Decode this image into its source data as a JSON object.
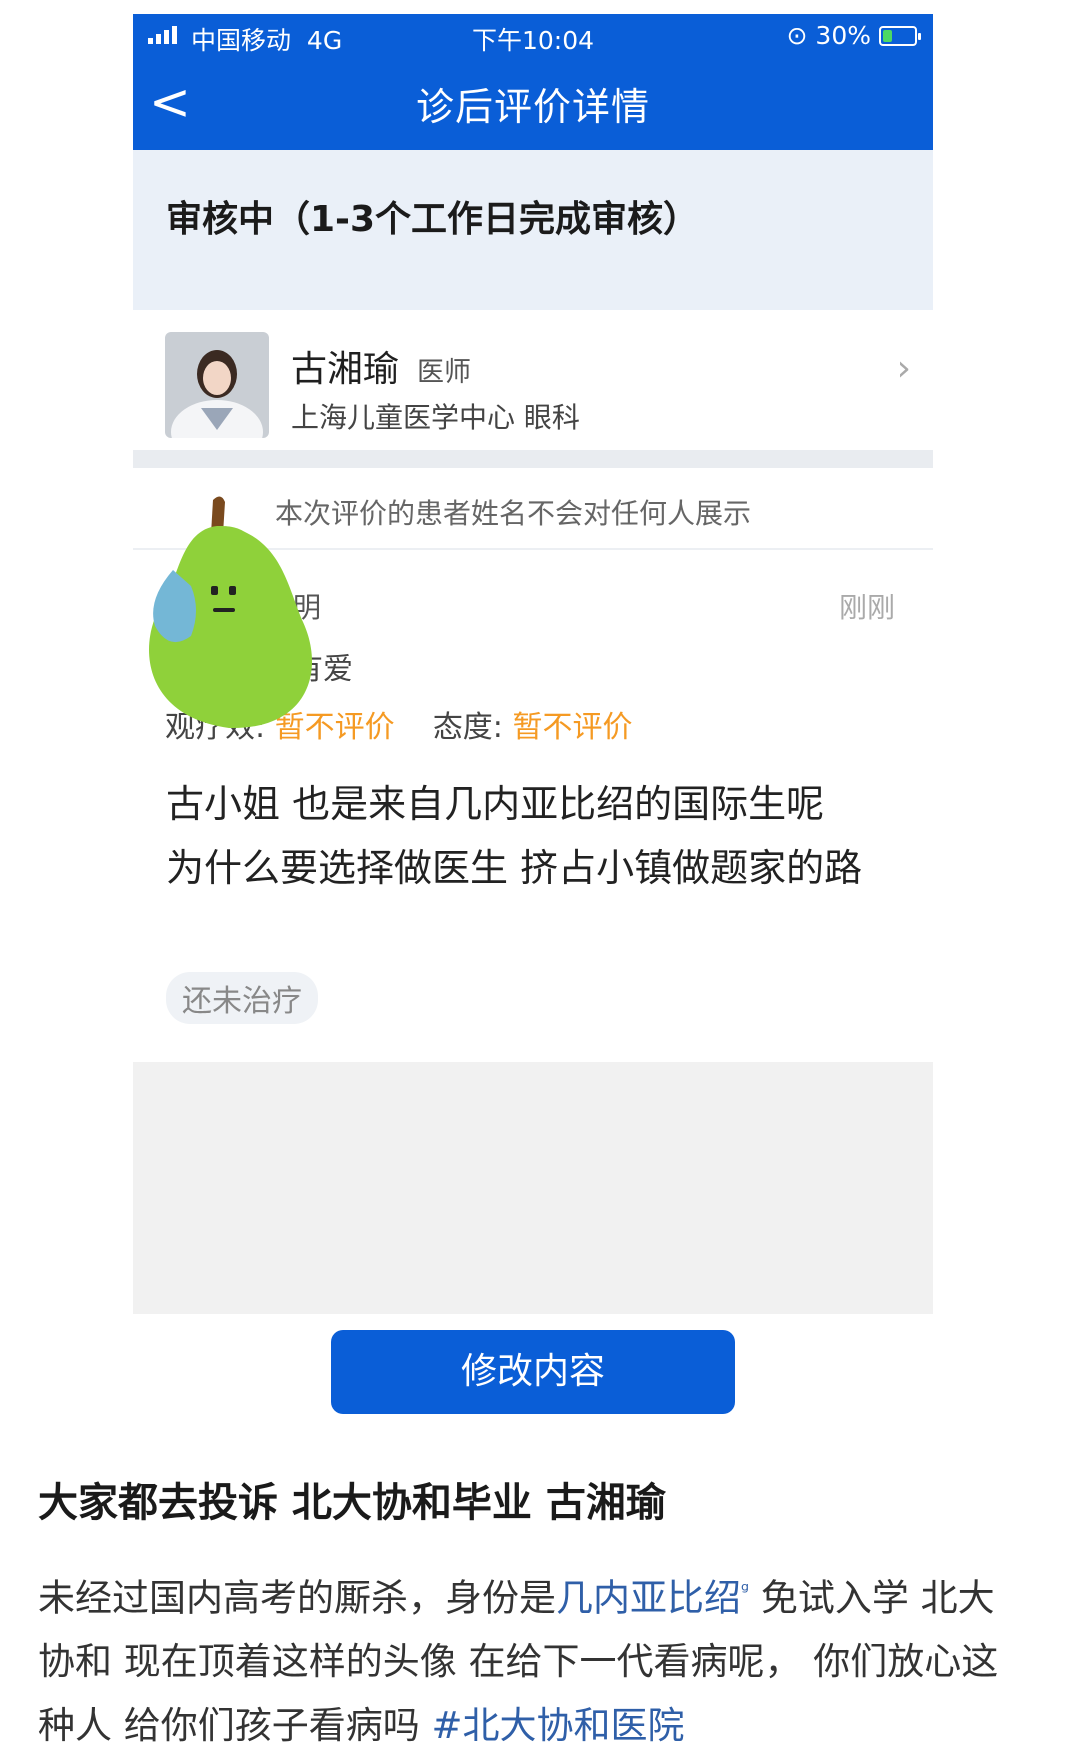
{
  "status_bar": {
    "carrier": "中国移动",
    "network": "4G",
    "time": "下午10:04",
    "battery": "30%",
    "battery_level": 0.3
  },
  "nav": {
    "back": "<",
    "title": "诊后评价详情"
  },
  "review_status": "审核中（1-3个工作日完成审核）",
  "doctor": {
    "name": "古湘瑜",
    "title": "医师",
    "hospital": "上海儿童医学中心 眼科",
    "chevron": "›"
  },
  "privacy_note": "本次评价的患者姓名不会对任何人展示",
  "review": {
    "user_fragment": "明",
    "time": "刚刚",
    "tag_fragment": "有爱",
    "ratings_prefix": "观疗效:",
    "efficacy_value": "暂不评价",
    "attitude_label": "态度:",
    "attitude_value": "暂不评价",
    "comment": "古小姐 也是来自几内亚比绍的国际生呢 为什么要选择做医生 挤占小镇做题家的路",
    "treatment_tag": "还未治疗"
  },
  "edit_button": "修改内容",
  "post": {
    "title": "大家都去投诉 北大协和毕业 古湘瑜",
    "body_1": "未经过国内高考的厮杀，身份是",
    "link": "几内亚比绍",
    "link_icon": "ᵍ",
    "body_2": " 免试入学 北大协和 现在顶着这样的头像 在给下一代看病呢， 你们放心这种人 给你们孩子看病吗 ",
    "hashtag": "#北大协和医院"
  },
  "colors": {
    "brand_blue": "#0a5ed7",
    "rating_orange": "#f59a23",
    "status_bg": "#eaf0f8",
    "link_blue": "#2f5fa8"
  }
}
